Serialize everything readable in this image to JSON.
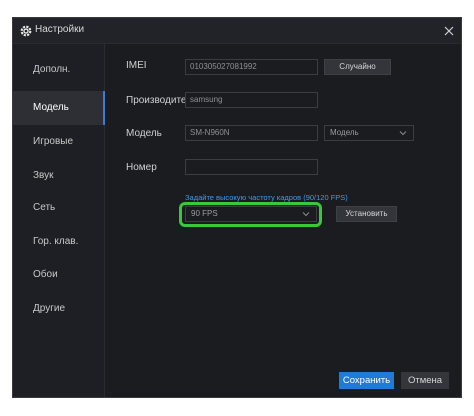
{
  "window": {
    "title": "Настройки"
  },
  "sidebar": {
    "items": [
      {
        "label": "Дополн."
      },
      {
        "label": "Модель"
      },
      {
        "label": "Игровые"
      },
      {
        "label": "Звук"
      },
      {
        "label": "Сеть"
      },
      {
        "label": "Гор. клав."
      },
      {
        "label": "Обои"
      },
      {
        "label": "Другие"
      }
    ],
    "active_index": 1
  },
  "form": {
    "imei_label": "IMEI",
    "imei_value": "010305027081992",
    "random_button": "Случайно",
    "manufacturer_label": "Производитель",
    "manufacturer_value": "samsung",
    "model_label": "Модель",
    "model_value": "SM-N960N",
    "model_select": "Модель",
    "number_label": "Номер",
    "number_value": "",
    "fps_hint": "Задайте высокую частоту кадров (90/120 FPS)",
    "fps_select": "90 FPS",
    "install_button": "Установить"
  },
  "footer": {
    "save_button": "Сохранить",
    "cancel_button": "Отмена"
  },
  "colors": {
    "accent": "#1e7bd8",
    "hint": "#3d9be9",
    "highlight": "#37c83b"
  },
  "icons": {
    "title": "gear-icon",
    "close": "close-icon",
    "dropdown": "chevron-down-icon"
  }
}
